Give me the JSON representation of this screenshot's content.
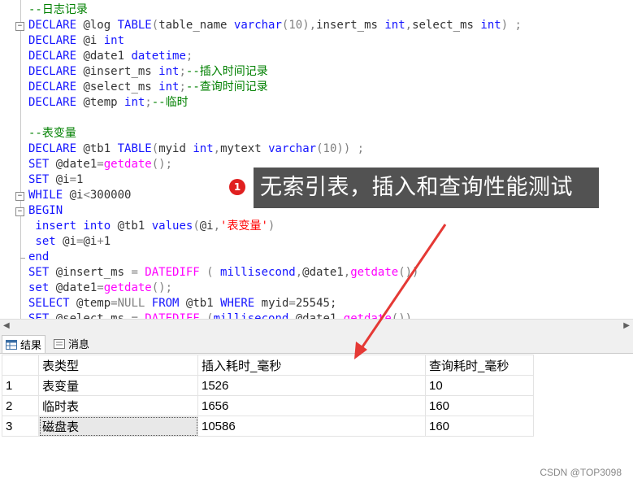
{
  "editor": {
    "lines": [
      {
        "parts": [
          {
            "t": "--日志记录",
            "c": "cm"
          }
        ]
      },
      {
        "parts": [
          {
            "t": "DECLARE ",
            "c": "kw"
          },
          {
            "t": "@log ",
            "c": "var"
          },
          {
            "t": "TABLE",
            "c": "kw"
          },
          {
            "t": "(",
            "c": "gr"
          },
          {
            "t": "table_name ",
            "c": "var"
          },
          {
            "t": "varchar",
            "c": "kw"
          },
          {
            "t": "(10)",
            "c": "gr"
          },
          {
            "t": ",",
            "c": "gr"
          },
          {
            "t": "insert_ms ",
            "c": "var"
          },
          {
            "t": "int",
            "c": "kw"
          },
          {
            "t": ",",
            "c": "gr"
          },
          {
            "t": "select_ms ",
            "c": "var"
          },
          {
            "t": "int",
            "c": "kw"
          },
          {
            "t": ") ;",
            "c": "gr"
          }
        ]
      },
      {
        "parts": [
          {
            "t": "DECLARE ",
            "c": "kw"
          },
          {
            "t": "@i ",
            "c": "var"
          },
          {
            "t": "int",
            "c": "kw"
          }
        ]
      },
      {
        "parts": [
          {
            "t": "DECLARE ",
            "c": "kw"
          },
          {
            "t": "@date1 ",
            "c": "var"
          },
          {
            "t": "datetime",
            "c": "kw"
          },
          {
            "t": ";",
            "c": "gr"
          }
        ]
      },
      {
        "parts": [
          {
            "t": "DECLARE ",
            "c": "kw"
          },
          {
            "t": "@insert_ms ",
            "c": "var"
          },
          {
            "t": "int",
            "c": "kw"
          },
          {
            "t": ";",
            "c": "gr"
          },
          {
            "t": "--插入时间记录",
            "c": "cm"
          }
        ]
      },
      {
        "parts": [
          {
            "t": "DECLARE ",
            "c": "kw"
          },
          {
            "t": "@select_ms ",
            "c": "var"
          },
          {
            "t": "int",
            "c": "kw"
          },
          {
            "t": ";",
            "c": "gr"
          },
          {
            "t": "--查询时间记录",
            "c": "cm"
          }
        ]
      },
      {
        "parts": [
          {
            "t": "DECLARE ",
            "c": "kw"
          },
          {
            "t": "@temp ",
            "c": "var"
          },
          {
            "t": "int",
            "c": "kw"
          },
          {
            "t": ";",
            "c": "gr"
          },
          {
            "t": "--临时",
            "c": "cm"
          }
        ]
      },
      {
        "parts": []
      },
      {
        "parts": [
          {
            "t": "--表变量",
            "c": "cm"
          }
        ]
      },
      {
        "parts": [
          {
            "t": "DECLARE ",
            "c": "kw"
          },
          {
            "t": "@tb1 ",
            "c": "var"
          },
          {
            "t": "TABLE",
            "c": "kw"
          },
          {
            "t": "(",
            "c": "gr"
          },
          {
            "t": "myid ",
            "c": "var"
          },
          {
            "t": "int",
            "c": "kw"
          },
          {
            "t": ",",
            "c": "gr"
          },
          {
            "t": "mytext ",
            "c": "var"
          },
          {
            "t": "varchar",
            "c": "kw"
          },
          {
            "t": "(10)) ;",
            "c": "gr"
          }
        ]
      },
      {
        "parts": [
          {
            "t": "SET ",
            "c": "kw"
          },
          {
            "t": "@date1",
            "c": "var"
          },
          {
            "t": "=",
            "c": "gr"
          },
          {
            "t": "getdate",
            "c": "fn"
          },
          {
            "t": "();",
            "c": "gr"
          }
        ]
      },
      {
        "parts": [
          {
            "t": "SET ",
            "c": "kw"
          },
          {
            "t": "@i",
            "c": "var"
          },
          {
            "t": "=",
            "c": "gr"
          },
          {
            "t": "1",
            "c": "var"
          }
        ]
      },
      {
        "parts": [
          {
            "t": "WHILE ",
            "c": "kw"
          },
          {
            "t": "@i",
            "c": "var"
          },
          {
            "t": "<",
            "c": "gr"
          },
          {
            "t": "300000",
            "c": "var"
          }
        ]
      },
      {
        "parts": [
          {
            "t": "BEGIN",
            "c": "kw"
          }
        ]
      },
      {
        "parts": [
          {
            "t": " insert into ",
            "c": "kw"
          },
          {
            "t": "@tb1 ",
            "c": "var"
          },
          {
            "t": "values",
            "c": "kw"
          },
          {
            "t": "(",
            "c": "gr"
          },
          {
            "t": "@i",
            "c": "var"
          },
          {
            "t": ",",
            "c": "gr"
          },
          {
            "t": "'表变量'",
            "c": "st"
          },
          {
            "t": ")",
            "c": "gr"
          }
        ]
      },
      {
        "parts": [
          {
            "t": " set ",
            "c": "kw"
          },
          {
            "t": "@i",
            "c": "var"
          },
          {
            "t": "=",
            "c": "gr"
          },
          {
            "t": "@i",
            "c": "var"
          },
          {
            "t": "+",
            "c": "gr"
          },
          {
            "t": "1",
            "c": "var"
          }
        ]
      },
      {
        "parts": [
          {
            "t": "end",
            "c": "kw"
          }
        ]
      },
      {
        "parts": [
          {
            "t": "SET ",
            "c": "kw"
          },
          {
            "t": "@insert_ms ",
            "c": "var"
          },
          {
            "t": "= ",
            "c": "gr"
          },
          {
            "t": "DATEDIFF ",
            "c": "fn"
          },
          {
            "t": "( ",
            "c": "gr"
          },
          {
            "t": "millisecond",
            "c": "kw"
          },
          {
            "t": ",",
            "c": "gr"
          },
          {
            "t": "@date1",
            "c": "var"
          },
          {
            "t": ",",
            "c": "gr"
          },
          {
            "t": "getdate",
            "c": "fn"
          },
          {
            "t": "())",
            "c": "gr"
          }
        ]
      },
      {
        "parts": [
          {
            "t": "set ",
            "c": "kw"
          },
          {
            "t": "@date1",
            "c": "var"
          },
          {
            "t": "=",
            "c": "gr"
          },
          {
            "t": "getdate",
            "c": "fn"
          },
          {
            "t": "();",
            "c": "gr"
          }
        ]
      },
      {
        "parts": [
          {
            "t": "SELECT ",
            "c": "kw"
          },
          {
            "t": "@temp",
            "c": "var"
          },
          {
            "t": "=",
            "c": "gr"
          },
          {
            "t": "NULL ",
            "c": "gr"
          },
          {
            "t": "FROM ",
            "c": "kw"
          },
          {
            "t": "@tb1 ",
            "c": "var"
          },
          {
            "t": "WHERE ",
            "c": "kw"
          },
          {
            "t": "myid",
            "c": "var"
          },
          {
            "t": "=",
            "c": "gr"
          },
          {
            "t": "25545;",
            "c": "var"
          }
        ]
      },
      {
        "parts": [
          {
            "t": "SET ",
            "c": "kw"
          },
          {
            "t": "@select_ms ",
            "c": "var"
          },
          {
            "t": "= ",
            "c": "gr"
          },
          {
            "t": "DATEDIFF ",
            "c": "fn"
          },
          {
            "t": "(",
            "c": "gr"
          },
          {
            "t": "millisecond",
            "c": "kw"
          },
          {
            "t": ",",
            "c": "gr"
          },
          {
            "t": "@date1",
            "c": "var"
          },
          {
            "t": ",",
            "c": "gr"
          },
          {
            "t": "getdate",
            "c": "fn"
          },
          {
            "t": "())",
            "c": "gr"
          }
        ]
      }
    ]
  },
  "tabs": {
    "results_label": "结果",
    "messages_label": "消息"
  },
  "results": {
    "columns": [
      "表类型",
      "插入耗时_毫秒",
      "查询耗时_毫秒"
    ],
    "rows": [
      {
        "num": "1",
        "cells": [
          "表变量",
          "1526",
          "10"
        ]
      },
      {
        "num": "2",
        "cells": [
          "临时表",
          "1656",
          "160"
        ]
      },
      {
        "num": "3",
        "cells": [
          "磁盘表",
          "10586",
          "160"
        ]
      }
    ]
  },
  "annotation": {
    "badge": "1",
    "text": "无索引表，插入和查询性能测试"
  },
  "watermark": "CSDN @TOP3098",
  "colors": {
    "keyword": "#1414ff",
    "comment": "#008000",
    "function": "#ff00ff",
    "string": "#ff0000",
    "arrow": "#e53935"
  }
}
